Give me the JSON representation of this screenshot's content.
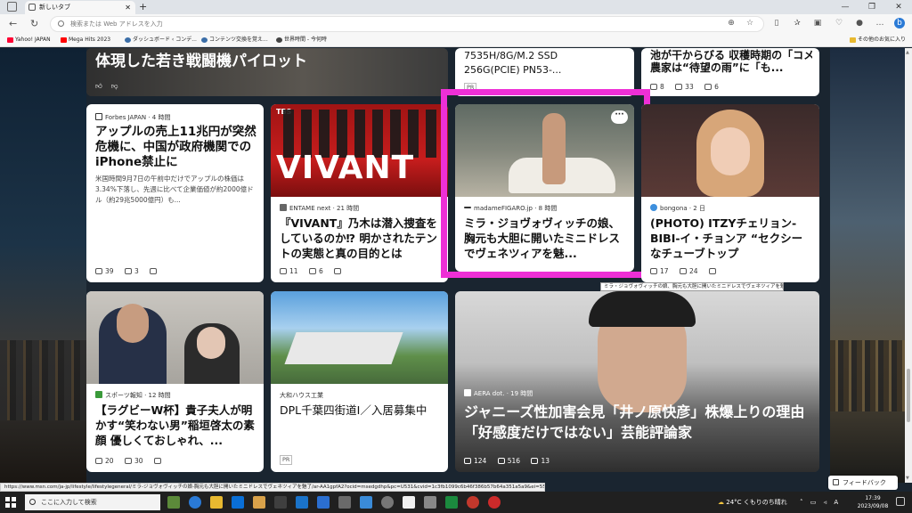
{
  "browser": {
    "tab_title": "新しいタブ",
    "address_placeholder": "検索または Web アドレスを入力",
    "bookmarks": [
      {
        "label": "Yahoo! JAPAN",
        "color": "#ff0033"
      },
      {
        "label": "Mega Hits 2023",
        "color": "#ff0000"
      },
      {
        "label": "ダッシュボード ‹ コンデ...",
        "color": "#3b6ea8"
      },
      {
        "label": "コンテンツ交換を覚え...",
        "color": "#3b6ea8"
      },
      {
        "label": "世界時間 - 今何時",
        "color": "#444444"
      }
    ],
    "other_favorites": "その他のお気に入り"
  },
  "cards": {
    "top_left": {
      "title": "体現した若き戦闘機パイロット"
    },
    "top_mid": {
      "title_l1": "7535H/8G/M.2 SSD",
      "title_l2": "256G(PCIE) PN53-...",
      "badge": "PR"
    },
    "top_right": {
      "title_l1": "池が干からびる 収穫時期の「コメ",
      "title_l2": "農家は“待望の雨”に「も...",
      "likes": "8",
      "dislikes": "33",
      "comments": "6"
    },
    "forbes": {
      "source": "Forbes JAPAN · 4 時間",
      "title": "アップルの売上11兆円が突然危機に、中国が政府機関でのiPhone禁止に",
      "body": "米国時間9月7日の午前中だけでアップルの株価は3.34%下落し、先週に比べて企業価値が約2000億ドル（約29兆5000億円）も...",
      "likes": "39",
      "dislikes": "3"
    },
    "vivant": {
      "image_text": "VIVANT",
      "image_badge": "TBS",
      "source": "ENTAME next · 21 時間",
      "title": "『VIVANT』乃木は潜入捜査をしているのか⁉ 明かされたテントの実態と真の目的とは",
      "likes": "11",
      "dislikes": "6"
    },
    "figaro": {
      "source": "madameFIGARO.jp · 8 時間",
      "title": "ミラ・ジョヴォヴィッチの娘、胸元も大胆に開いたミニドレスでヴェネツィアを魅...",
      "more": "···"
    },
    "itzy": {
      "source": "bongona · 2 日",
      "title": "(PHOTO) ITZYチェリョン-BIBI-イ・チョンア “セクシーなチューブトップ",
      "likes": "17",
      "dislikes": "24"
    },
    "rugby": {
      "source": "スポーツ報知 · 12 時間",
      "title": "【ラグビーW杯】貴子夫人が明かす“笑わない男”稲垣啓太の素顔 優しくておしゃれ、...",
      "likes": "20",
      "dislikes": "30"
    },
    "daiwa": {
      "source": "大和ハウス工業",
      "title": "DPL千葉四街道Ⅰ／入居募集中",
      "badge": "PR"
    },
    "aera": {
      "source": "AERA dot. · 19 時間",
      "title": "ジャニーズ性加害会見「井ノ原快彦」株爆上りの理由「好感度だけではない」芸能評論家",
      "likes": "124",
      "dislikes": "516",
      "comments": "13"
    }
  },
  "tooltip": "ミラ・ジョヴォヴィッチの娘、胸元も大胆に開いたミニドレスでヴェネツィアを魅了！",
  "status_url": "https://www.msn.com/ja-jp/lifestyle/lifestylegeneral/ミラ-ジョヴォヴィッチの娘-胸元も大胆に開いたミニドレスでヴェネツィアを魅了/ar-AA1gpfA2?ocid=msedgdhp&pc=U531&cvid=1c3fb1099c6b46f386b57b64a351a5a9&ei=55",
  "feedback": "フィードバック",
  "taskbar": {
    "search_placeholder": "ここに入力して検索",
    "weather": "24°C くもりのち晴れ",
    "ime": "A",
    "time": "17:39",
    "date": "2023/09/08"
  },
  "colors": {
    "highlight": "#ee2fd6",
    "accent": "#0067c0"
  }
}
